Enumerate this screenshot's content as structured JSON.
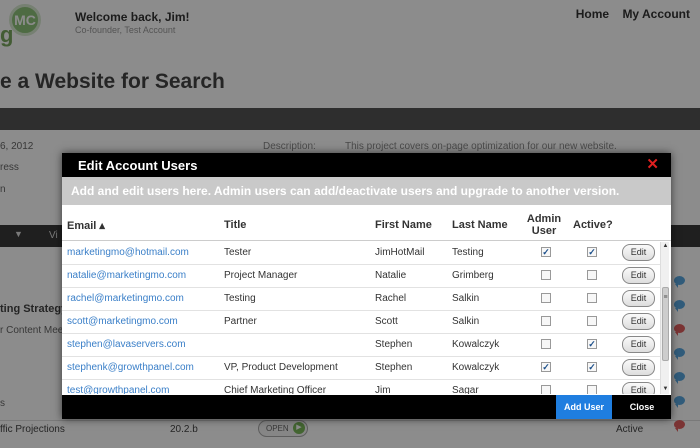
{
  "header": {
    "logo_text": "MC",
    "welcome": "Welcome back, Jim!",
    "subtitle": "Co-founder, Test Account",
    "nav": [
      "Home",
      "My Account"
    ]
  },
  "page": {
    "title": "e a Website for Search",
    "date_fragment": "6, 2012",
    "ress_fragment": "ress",
    "on_fragment": "n",
    "description_label": "Description:",
    "description_text": "This project covers on-page optimization for our new website.",
    "band_item": "Vi",
    "strategy_fragment": "ting Strategy",
    "content_fragment": "r Content Mee",
    "s_fragment": "s",
    "bottom_row": {
      "name": "ffic Projections",
      "version": "20.2.b",
      "status": "OPEN",
      "active": "Active"
    }
  },
  "modal": {
    "title": "Edit Account Users",
    "close_symbol": "✕",
    "subtitle": "Add and edit users here. Admin users can add/deactivate users and upgrade to another version.",
    "columns": {
      "email": "Email ▴",
      "title": "Title",
      "first": "First Name",
      "last": "Last Name",
      "admin": "Admin User",
      "active": "Active?"
    },
    "rows": [
      {
        "email": "marketingmo@hotmail.com",
        "title": "Tester",
        "first": "JimHotMail",
        "last": "Testing",
        "admin": true,
        "active": true
      },
      {
        "email": "natalie@marketingmo.com",
        "title": "Project Manager",
        "first": "Natalie",
        "last": "Grimberg",
        "admin": false,
        "active": false
      },
      {
        "email": "rachel@marketingmo.com",
        "title": "Testing",
        "first": "Rachel",
        "last": "Salkin",
        "admin": false,
        "active": false
      },
      {
        "email": "scott@marketingmo.com",
        "title": "Partner",
        "first": "Scott",
        "last": "Salkin",
        "admin": false,
        "active": false
      },
      {
        "email": "stephen@lavaservers.com",
        "title": "",
        "first": "Stephen",
        "last": "Kowalczyk",
        "admin": false,
        "active": true
      },
      {
        "email": "stephenk@growthpanel.com",
        "title": "VP, Product Development",
        "first": "Stephen",
        "last": "Kowalczyk",
        "admin": true,
        "active": true
      },
      {
        "email": "test@growthpanel.com",
        "title": "Chief Marketing Officer",
        "first": "Jim",
        "last": "Sagar",
        "admin": false,
        "active": false
      }
    ],
    "edit_label": "Edit",
    "add_user_label": "Add User",
    "close_label": "Close"
  }
}
